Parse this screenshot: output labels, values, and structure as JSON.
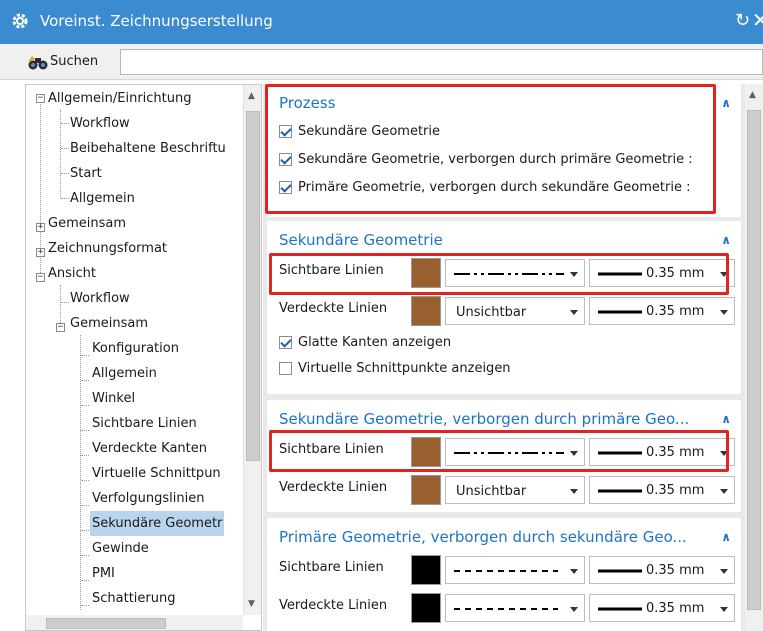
{
  "window": {
    "title": "Voreinst. Zeichnungserstellung",
    "reset_icon": "↻",
    "close_icon": "✕"
  },
  "search": {
    "label": "Suchen",
    "value": ""
  },
  "tree": {
    "scroll_up": "▲",
    "scroll_down": "▼",
    "items": [
      {
        "label": "Allgemein/Einrichtung",
        "expander": "−"
      },
      {
        "label": "Workflow"
      },
      {
        "label": "Beibehaltene Beschriftu"
      },
      {
        "label": "Start"
      },
      {
        "label": "Allgemein"
      },
      {
        "label": "Gemeinsam",
        "expander": "+"
      },
      {
        "label": "Zeichnungsformat",
        "expander": "+"
      },
      {
        "label": "Ansicht",
        "expander": "−"
      },
      {
        "label": "Workflow"
      },
      {
        "label": "Gemeinsam",
        "expander": "−"
      },
      {
        "label": "Konfiguration"
      },
      {
        "label": "Allgemein"
      },
      {
        "label": "Winkel"
      },
      {
        "label": "Sichtbare Linien"
      },
      {
        "label": "Verdeckte Kanten"
      },
      {
        "label": "Virtuelle Schnittpun"
      },
      {
        "label": "Verfolgungslinien"
      },
      {
        "label": "Sekundäre Geometr",
        "selected": true
      },
      {
        "label": "Gewinde"
      },
      {
        "label": "PMI"
      },
      {
        "label": "Schattierung"
      }
    ]
  },
  "prozess": {
    "title": "Prozess",
    "collapse": "∧",
    "options": [
      {
        "label": "Sekundäre Geometrie",
        "checked": true
      },
      {
        "label": "Sekundäre Geometrie, verborgen durch primäre Geometrie :",
        "checked": true
      },
      {
        "label": "Primäre Geometrie, verborgen durch sekundäre Geometrie :",
        "checked": true
      }
    ]
  },
  "sek": {
    "title": "Sekundäre Geometrie",
    "collapse": "∧",
    "visible": {
      "label": "Sichtbare Linien",
      "color": "#98602e",
      "style": "dash-dot-dot",
      "width": "0.35 mm"
    },
    "hidden": {
      "label": "Verdeckte Linien",
      "color": "#98602e",
      "style": "Unsichtbar",
      "width": "0.35 mm"
    },
    "options": [
      {
        "label": "Glatte Kanten anzeigen",
        "checked": true
      },
      {
        "label": "Virtuelle Schnittpunkte anzeigen",
        "checked": false
      }
    ]
  },
  "sek_hidden": {
    "title": "Sekundäre Geometrie, verborgen durch primäre Geo...",
    "collapse": "∧",
    "visible": {
      "label": "Sichtbare Linien",
      "color": "#98602e",
      "style": "dash-dot-dot",
      "width": "0.35 mm"
    },
    "hidden": {
      "label": "Verdeckte Linien",
      "color": "#98602e",
      "style": "Unsichtbar",
      "width": "0.35 mm"
    }
  },
  "prim_hidden": {
    "title": "Primäre Geometrie, verborgen durch sekundäre Geo...",
    "collapse": "∧",
    "visible": {
      "label": "Sichtbare Linien",
      "color": "#000000",
      "style": "dashed",
      "width": "0.35 mm"
    },
    "hidden": {
      "label": "Verdeckte Linien",
      "color": "#000000",
      "style": "dashed",
      "width": "0.35 mm"
    }
  },
  "colors": {
    "titlebar": "#3b8bd0",
    "section_title": "#1d74c7",
    "highlight": "#e02424",
    "selection": "#b9d5ee"
  }
}
